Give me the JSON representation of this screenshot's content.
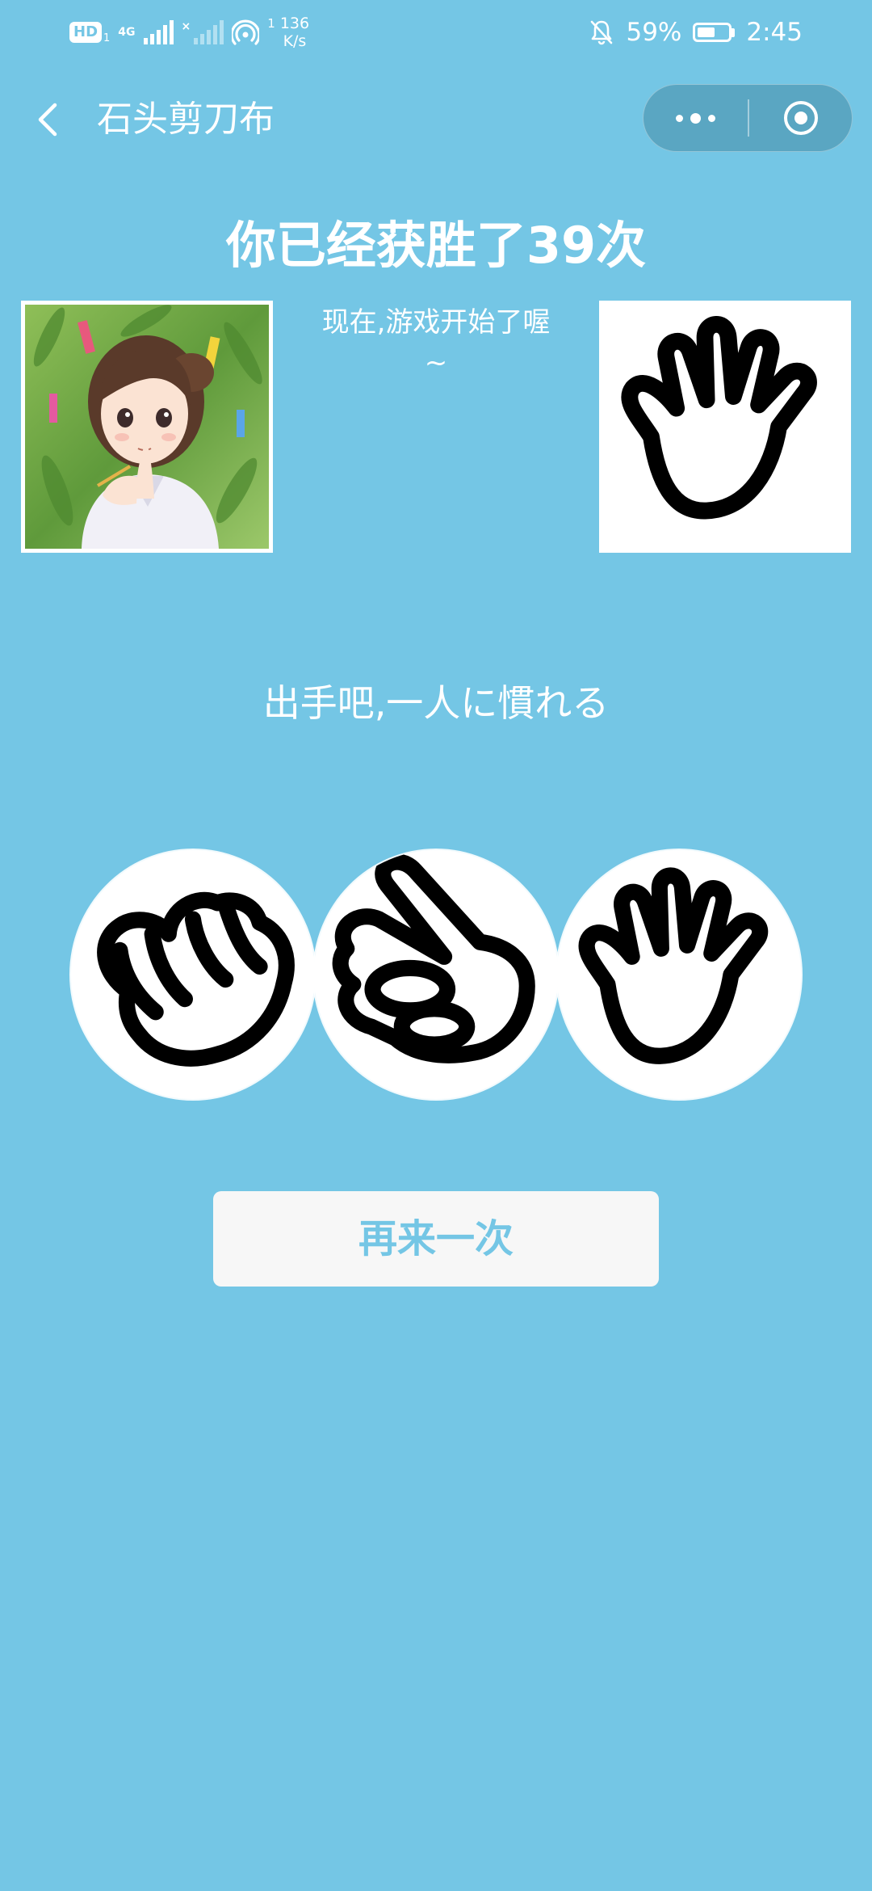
{
  "status_bar": {
    "hd_label": "HD",
    "hd_sub": "1",
    "network_type": "4G",
    "no_signal_mark": "×",
    "hotspot_sup": "1",
    "speed_value": "136",
    "speed_unit": "K/s",
    "battery_percent_label": "59%",
    "battery_level": 0.59,
    "time": "2:45"
  },
  "nav": {
    "title": "石头剪刀布"
  },
  "game": {
    "wins_text": "你已经获胜了39次",
    "status_line1": "现在,游戏开始了喔",
    "status_line2": "~",
    "prompt": "出手吧,一人に慣れる",
    "opponent_hand": "paper-hand",
    "choices": [
      {
        "name": "rock",
        "icon": "rock-hand-icon"
      },
      {
        "name": "scissors",
        "icon": "scissors-hand-icon"
      },
      {
        "name": "paper",
        "icon": "paper-hand-icon"
      }
    ],
    "retry_label": "再来一次"
  },
  "colors": {
    "background": "#74c6e5",
    "button_bg": "#f7f7f7",
    "button_text": "#74c6e5"
  }
}
